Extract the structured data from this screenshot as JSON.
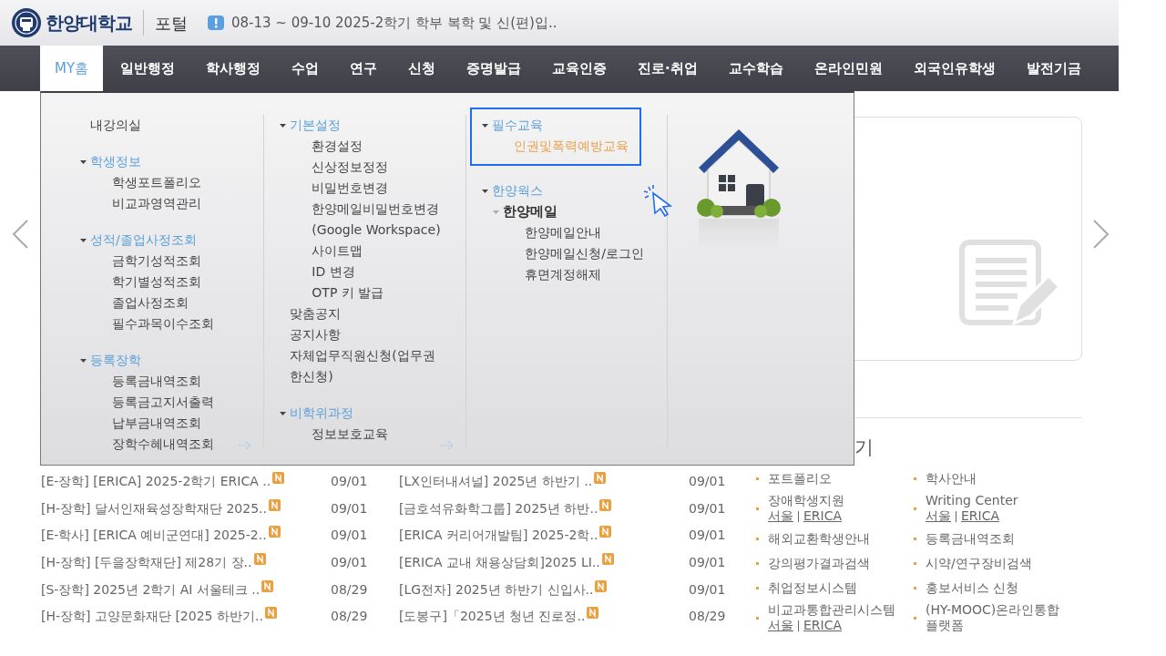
{
  "header": {
    "logo_text": "한양대학교",
    "portal_label": "포털",
    "notice": "08-13 ~ 09-10 2025-2학기 학부 복학 및 신(편)입.."
  },
  "nav": [
    {
      "label": "MY홈",
      "selected": true
    },
    {
      "label": "일반행정",
      "selected": false
    },
    {
      "label": "학사행정",
      "selected": false
    },
    {
      "label": "수업",
      "selected": false
    },
    {
      "label": "연구",
      "selected": false
    },
    {
      "label": "신청",
      "selected": false
    },
    {
      "label": "증명발급",
      "selected": false
    },
    {
      "label": "교육인증",
      "selected": false
    },
    {
      "label": "진로·취업",
      "selected": false
    },
    {
      "label": "교수학습",
      "selected": false
    },
    {
      "label": "온라인민원",
      "selected": false
    },
    {
      "label": "외국인유학생",
      "selected": false
    },
    {
      "label": "발전기금",
      "selected": false
    }
  ],
  "mega_menu": {
    "columns": [
      {
        "more_arrow": true,
        "items": [
          {
            "kind": "item",
            "label": "내강의실",
            "active": false
          },
          {
            "kind": "group",
            "label": "학생정보",
            "highlighted": false,
            "children": [
              {
                "kind": "item",
                "label": "학생포트폴리오",
                "active": false
              },
              {
                "kind": "item",
                "label": "비교과영역관리",
                "active": false
              }
            ]
          },
          {
            "kind": "group",
            "label": "성적/졸업사정조회",
            "highlighted": false,
            "children": [
              {
                "kind": "item",
                "label": "금학기성적조회",
                "active": false
              },
              {
                "kind": "item",
                "label": "학기별성적조회",
                "active": false
              },
              {
                "kind": "item",
                "label": "졸업사정조회",
                "active": false
              },
              {
                "kind": "item",
                "label": "필수과목이수조회",
                "active": false
              }
            ]
          },
          {
            "kind": "group",
            "label": "등록장학",
            "highlighted": false,
            "children": [
              {
                "kind": "item",
                "label": "등록금내역조회",
                "active": false
              },
              {
                "kind": "item",
                "label": "등록금고지서출력",
                "active": false
              },
              {
                "kind": "item",
                "label": "납부금내역조회",
                "active": false
              },
              {
                "kind": "item",
                "label": "장학수혜내역조회",
                "active": false
              }
            ]
          }
        ]
      },
      {
        "more_arrow": true,
        "items": [
          {
            "kind": "group",
            "label": "기본설정",
            "highlighted": false,
            "children": [
              {
                "kind": "item",
                "label": "환경설정",
                "active": false
              },
              {
                "kind": "item",
                "label": "신상정보정정",
                "active": false
              },
              {
                "kind": "item",
                "label": "비밀번호변경",
                "active": false
              },
              {
                "kind": "item",
                "label": "한양메일비밀번호변경(Google Workspace)",
                "active": false
              },
              {
                "kind": "item",
                "label": "사이트맵",
                "active": false
              },
              {
                "kind": "item",
                "label": "ID 변경",
                "active": false
              },
              {
                "kind": "item",
                "label": "OTP 키 발급",
                "active": false
              }
            ]
          },
          {
            "kind": "item",
            "label": "맞춤공지",
            "active": false
          },
          {
            "kind": "item",
            "label": "공지사항",
            "active": false
          },
          {
            "kind": "item",
            "label": "자체업무직원신청(업무권한신청)",
            "active": false
          },
          {
            "kind": "group",
            "label": "비학위과정",
            "highlighted": false,
            "children": [
              {
                "kind": "item",
                "label": "정보보호교육",
                "active": false
              }
            ]
          }
        ]
      },
      {
        "more_arrow": false,
        "items": [
          {
            "kind": "group",
            "label": "필수교육",
            "highlighted": true,
            "children": [
              {
                "kind": "item",
                "label": "인권및폭력예방교육",
                "active": true
              }
            ]
          },
          {
            "kind": "group",
            "label": "한양웍스",
            "highlighted": false,
            "children": [
              {
                "kind": "subgroup",
                "label": "한양메일",
                "children": [
                  {
                    "kind": "item",
                    "label": "한양메일안내",
                    "active": false
                  },
                  {
                    "kind": "item",
                    "label": "한양메일신청/로그인",
                    "active": false
                  },
                  {
                    "kind": "item",
                    "label": "휴면계정해제",
                    "active": false
                  }
                ]
              }
            ]
          }
        ]
      }
    ]
  },
  "section_title": "기",
  "notice_columns": [
    [
      {
        "title": "[E-장학] [ERICA] 2025-2학기 ERICA ..",
        "date": "09/01",
        "new": true
      },
      {
        "title": "[H-장학] 달서인재육성장학재단 2025..",
        "date": "09/01",
        "new": true
      },
      {
        "title": "[E-학사] [ERICA 예비군연대] 2025-2..",
        "date": "09/01",
        "new": true
      },
      {
        "title": "[H-장학] [두을장학재단] 제28기 장..",
        "date": "09/01",
        "new": true
      },
      {
        "title": "[S-장학] 2025년 2학기 AI 서울테크 ..",
        "date": "08/29",
        "new": true
      },
      {
        "title": "[H-장학] 고양문화재단 [2025 하반기..",
        "date": "08/29",
        "new": true
      }
    ],
    [
      {
        "title": "[LX인터내셔널] 2025년 하반기 ..",
        "date": "09/01",
        "new": true
      },
      {
        "title": "[금호석유화학그룹] 2025년 하반..",
        "date": "09/01",
        "new": true
      },
      {
        "title": "[ERICA 커리어개발팀] 2025-2학..",
        "date": "09/01",
        "new": true
      },
      {
        "title": "[ERICA 교내 채용상담회]2025 LI..",
        "date": "09/01",
        "new": true
      },
      {
        "title": "[LG전자] 2025년 하반기 신입사..",
        "date": "09/01",
        "new": true
      },
      {
        "title": "[도봉구]「2025년 청년 진로정..",
        "date": "08/29",
        "new": true
      }
    ]
  ],
  "quick_links": [
    {
      "label": "포트폴리오"
    },
    {
      "label": "학사안내"
    },
    {
      "label": "장애학생지원",
      "links": [
        "서울",
        "ERICA"
      ]
    },
    {
      "label": "Writing Center",
      "links": [
        "서울",
        "ERICA"
      ]
    },
    {
      "label": "해외교환학생안내"
    },
    {
      "label": "등록금내역조회"
    },
    {
      "label": "강의평가결과검색"
    },
    {
      "label": "시약/연구장비검색"
    },
    {
      "label": "취업정보시스템"
    },
    {
      "label": "홍보서비스 신청"
    },
    {
      "label": "비교과통합관리시스템",
      "links": [
        "서울",
        "ERICA"
      ]
    },
    {
      "label": "(HY-MOOC)온라인통합플랫폼"
    }
  ]
}
